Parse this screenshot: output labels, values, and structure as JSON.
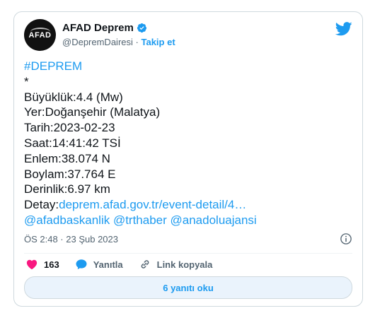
{
  "account": {
    "name": "AFAD Deprem",
    "handle": "@DepremDairesi",
    "separator": "·",
    "follow_label": "Takip et",
    "avatar_text": "AFAD"
  },
  "tweet": {
    "hashtag": "#DEPREM",
    "asterisk": "*",
    "lines": [
      "Büyüklük:4.4 (Mw)",
      "Yer:Doğanşehir (Malatya)",
      "Tarih:2023-02-23",
      "Saat:14:41:42 TSİ",
      "Enlem:38.074 N",
      "Boylam:37.764 E",
      "Derinlik:6.97 km"
    ],
    "detail_prefix": "Detay:",
    "detail_link": "deprem.afad.gov.tr/event-detail/4…",
    "mentions": "@afadbaskanlik @trthaber @anadoluajansi"
  },
  "meta": {
    "timestamp": "ÖS 2:48 · 23 Şub 2023"
  },
  "actions": {
    "likes": "163",
    "reply_label": "Yanıtla",
    "copy_link_label": "Link kopyala"
  },
  "replies_button": "6 yanıtı oku",
  "colors": {
    "accent": "#1d9bf0",
    "like": "#f91880",
    "text": "#0f1419",
    "muted": "#536471"
  }
}
